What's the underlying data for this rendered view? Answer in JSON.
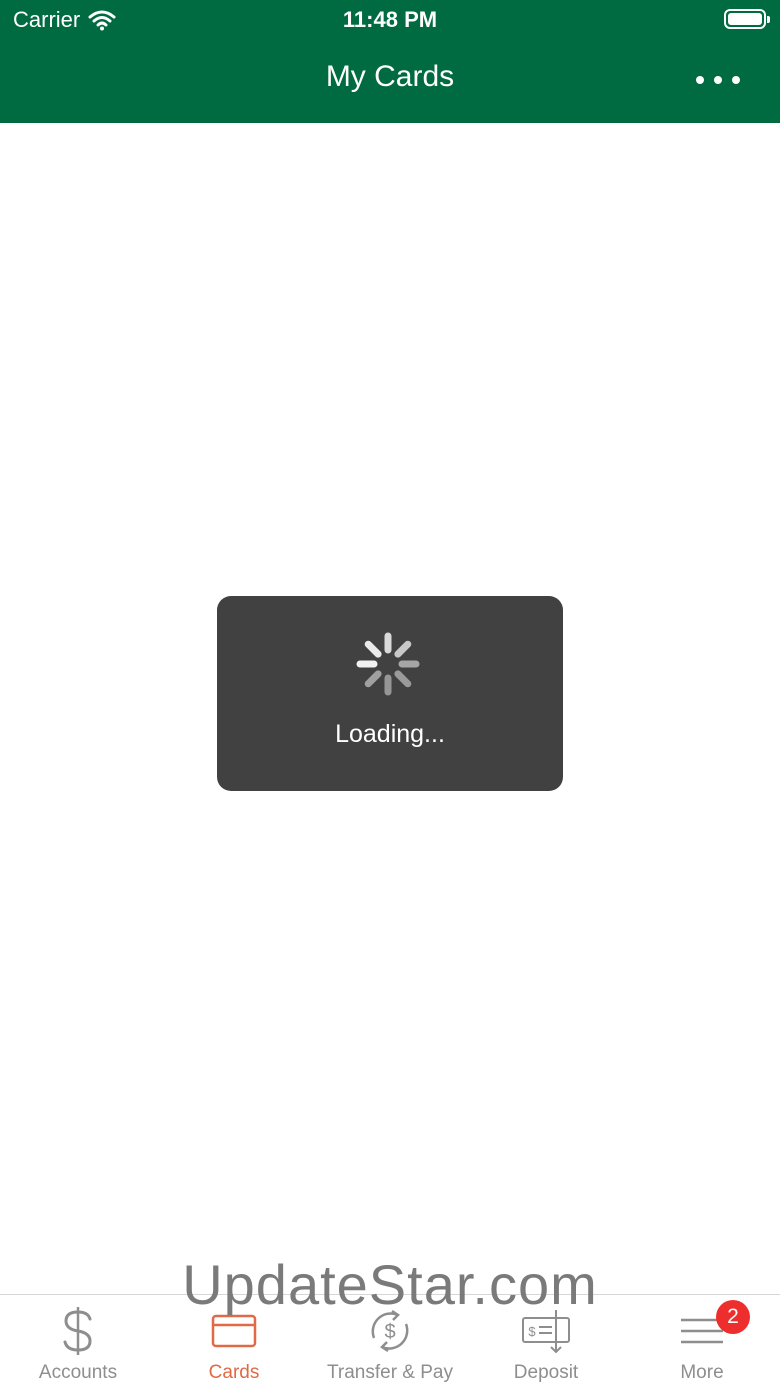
{
  "status_bar": {
    "carrier": "Carrier",
    "time": "11:48 PM"
  },
  "header": {
    "title": "My Cards"
  },
  "loading": {
    "text": "Loading..."
  },
  "watermark": "UpdateStar.com",
  "tabs": [
    {
      "label": "Accounts",
      "icon": "dollar-icon"
    },
    {
      "label": "Cards",
      "icon": "card-icon",
      "active": true
    },
    {
      "label": "Transfer & Pay",
      "icon": "transfer-icon"
    },
    {
      "label": "Deposit",
      "icon": "check-deposit-icon"
    },
    {
      "label": "More",
      "icon": "menu-icon",
      "badge": "2"
    }
  ],
  "colors": {
    "header_bg": "#006a40",
    "active_tab": "#e06a45",
    "inactive_tab": "#8e8e8e",
    "badge": "#ee2d2d",
    "hud_bg": "#414141"
  }
}
